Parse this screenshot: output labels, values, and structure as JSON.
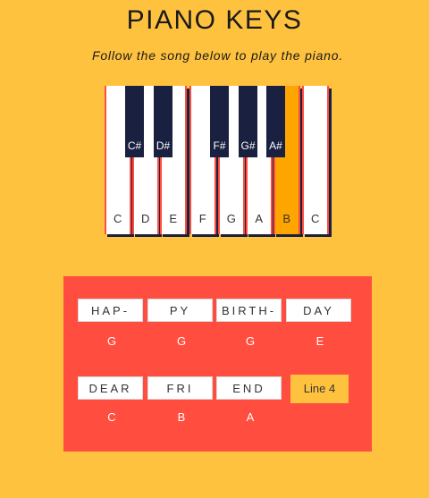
{
  "header": {
    "title": "PIANO KEYS",
    "subtitle": "Follow the song below to play the piano."
  },
  "piano": {
    "white_keys": [
      "C",
      "D",
      "E",
      "F",
      "G",
      "A",
      "B",
      "C"
    ],
    "black_keys": [
      "C#",
      "D#",
      "F#",
      "G#",
      "A#"
    ],
    "active_key": "B",
    "colors": {
      "white": "#ffffff",
      "black": "#1A2040",
      "active": "#FFA500",
      "key_border": "#FF4D3F"
    }
  },
  "song": {
    "lines": [
      {
        "syllables": [
          "HAP-",
          "PY",
          "BIRTH-",
          "DAY"
        ],
        "notes": [
          "G",
          "G",
          "G",
          "E"
        ]
      },
      {
        "syllables": [
          "DEAR",
          "FRI",
          "END"
        ],
        "notes": [
          "C",
          "B",
          "A"
        ]
      }
    ],
    "next_line_label": "Line 4"
  },
  "colors": {
    "background": "#FFC23F",
    "panel": "#FF4D3F",
    "button": "#FFC23F"
  }
}
